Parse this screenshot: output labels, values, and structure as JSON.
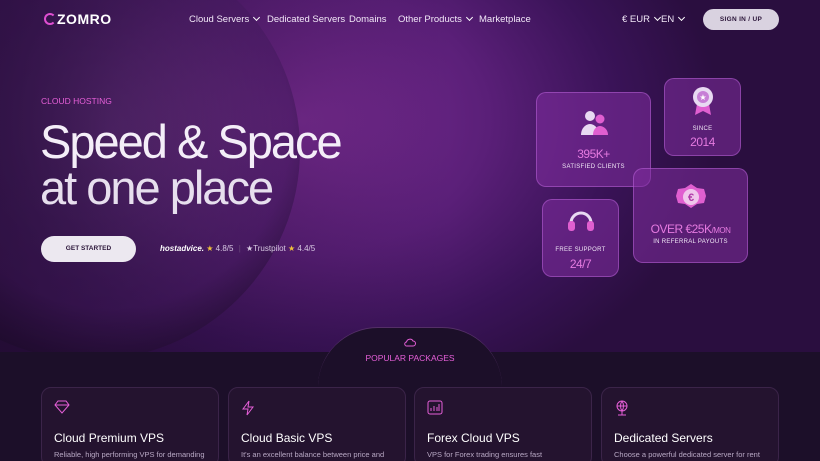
{
  "nav": {
    "logo": "ZOMRO",
    "items": [
      {
        "label": "Cloud Servers",
        "dropdown": true
      },
      {
        "label": "Dedicated Servers",
        "dropdown": false
      },
      {
        "label": "Domains",
        "dropdown": false
      },
      {
        "label": "Other Products",
        "dropdown": true
      },
      {
        "label": "Marketplace",
        "dropdown": false
      }
    ],
    "currency": "€ EUR",
    "language": "EN",
    "signin": "SIGN IN / UP"
  },
  "hero": {
    "eyebrow": "CLOUD HOSTING",
    "title_line1": "Speed & Space",
    "title_line2": "at one place",
    "cta": "GET STARTED",
    "ratings": [
      {
        "brand": "hostadvice.",
        "score": "4.8/5"
      },
      {
        "brand": "Trustpilot",
        "score": "4.4/5"
      }
    ]
  },
  "stats": {
    "clients": {
      "value": "395K+",
      "label": "SATISFIED CLIENTS",
      "icon": "users-icon"
    },
    "since": {
      "label": "SINCE",
      "value": "2014",
      "icon": "award-icon"
    },
    "payouts": {
      "value": "OVER €25K",
      "unit": "/MON",
      "label": "IN REFERRAL PAYOUTS",
      "icon": "euro-badge-icon"
    },
    "support": {
      "label": "FREE SUPPORT",
      "value": "24/7",
      "icon": "headset-icon"
    }
  },
  "packages": {
    "heading": "POPULAR PACKAGES",
    "items": [
      {
        "title": "Cloud Premium VPS",
        "desc": "Reliable, high performing VPS for demanding",
        "icon": "diamond-icon"
      },
      {
        "title": "Cloud Basic VPS",
        "desc": "It's an excellent balance between price and",
        "icon": "lightning-icon"
      },
      {
        "title": "Forex Cloud VPS",
        "desc": "VPS for Forex trading ensures fast",
        "icon": "chart-icon"
      },
      {
        "title": "Dedicated Servers",
        "desc": "Choose a powerful dedicated server for rent",
        "icon": "globe-icon"
      }
    ]
  },
  "colors": {
    "accent": "#e65fd8",
    "background": "#1c0f29",
    "hero": "#5a1f78"
  }
}
